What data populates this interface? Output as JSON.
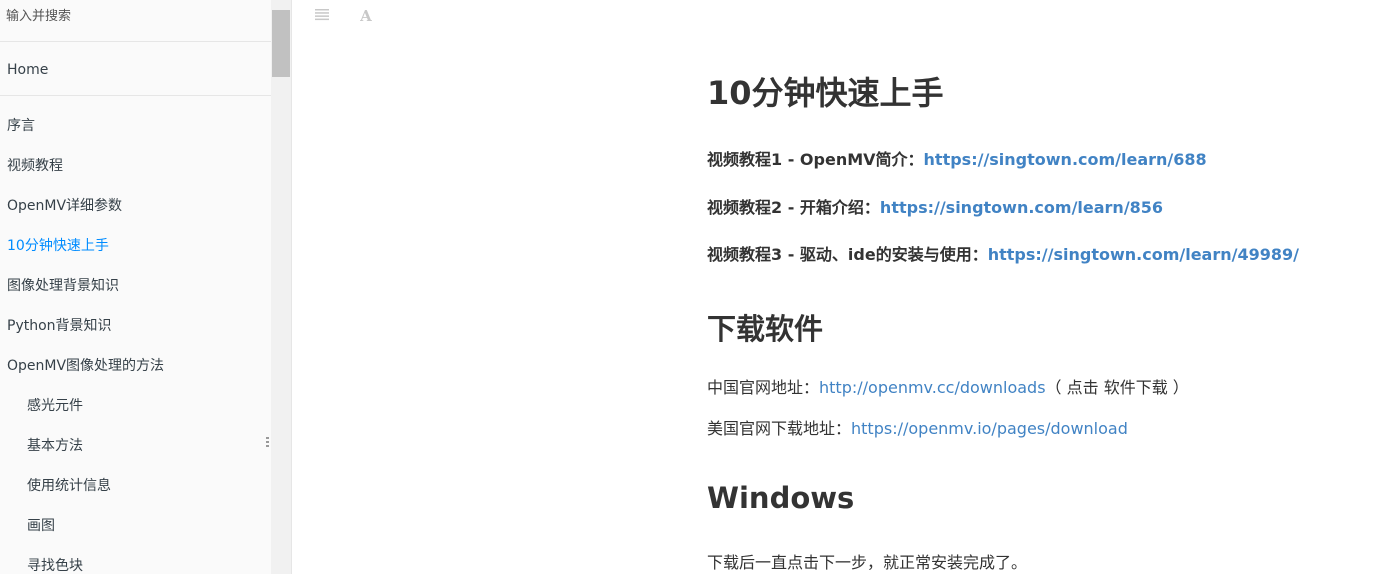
{
  "search": {
    "placeholder": "输入并搜索"
  },
  "sidebar": {
    "home": "Home",
    "items": [
      {
        "label": "序言"
      },
      {
        "label": "视频教程"
      },
      {
        "label": "OpenMV详细参数"
      },
      {
        "label": "10分钟快速上手",
        "active": true
      },
      {
        "label": "图像处理背景知识"
      },
      {
        "label": "Python背景知识"
      },
      {
        "label": "OpenMV图像处理的方法"
      },
      {
        "label": "感光元件"
      },
      {
        "label": "基本方法"
      },
      {
        "label": "使用统计信息"
      },
      {
        "label": "画图"
      },
      {
        "label": "寻找色块"
      }
    ]
  },
  "toolbar": {
    "toc_icon": "list-icon",
    "font_icon": "font-settings-icon",
    "font_glyph": "A"
  },
  "content": {
    "title": "10分钟快速上手",
    "videos": [
      {
        "label": "视频教程1 - OpenMV简介：",
        "url": "https://singtown.com/learn/688"
      },
      {
        "label": "视频教程2 - 开箱介绍：",
        "url": "https://singtown.com/learn/856"
      },
      {
        "label": "视频教程3 - 驱动、ide的安装与使用：",
        "url": "https://singtown.com/learn/49989/"
      }
    ],
    "download_heading": "下载软件",
    "cn_label": "中国官网地址：",
    "cn_url": "http://openmv.cc/downloads",
    "cn_note": "（ 点击 软件下载 ）",
    "us_label": "美国官网下载地址：",
    "us_url": "https://openmv.io/pages/download",
    "windows_heading": "Windows",
    "windows_text": "下载后一直点击下一步，就正常安装完成了。"
  },
  "colors": {
    "link": "#4183c4",
    "active_nav": "#008cff"
  }
}
